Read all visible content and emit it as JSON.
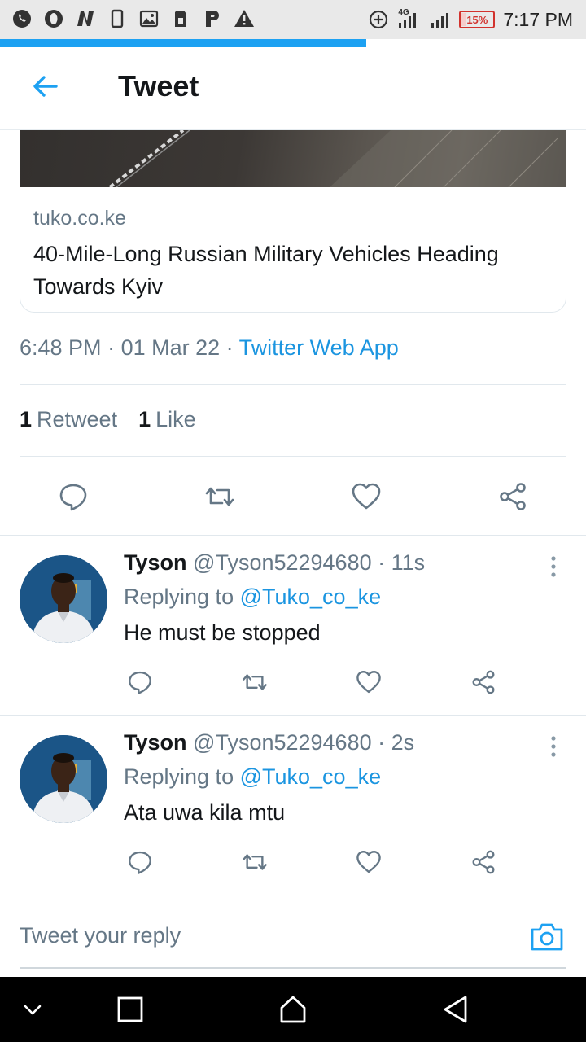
{
  "status_bar": {
    "time": "7:17 PM",
    "battery": "15%",
    "battery_level": 0.15,
    "network": "4G",
    "notification_icons": [
      "whatsapp-icon",
      "opera-icon",
      "n-news-icon",
      "phone-icon",
      "gallery-icon",
      "sim-icon",
      "p-app-icon",
      "warning-icon"
    ]
  },
  "page_load_progress": 0.625,
  "header": {
    "title": "Tweet"
  },
  "link_card": {
    "domain": "tuko.co.ke",
    "title": "40-Mile-Long Russian Military Vehicles Heading Towards Kyiv"
  },
  "tweet_meta": {
    "time": "6:48 PM",
    "date": "01 Mar 22",
    "separator": " · ",
    "source": "Twitter Web App"
  },
  "stats": {
    "retweet_count": "1",
    "retweet_label": "Retweet",
    "like_count": "1",
    "like_label": "Like"
  },
  "replies": [
    {
      "name": "Tyson",
      "handle": "@Tyson52294680",
      "time": "· 11s",
      "replying_prefix": "Replying to",
      "replying_to": "@Tuko_co_ke",
      "text": "He must be stopped"
    },
    {
      "name": "Tyson",
      "handle": "@Tyson52294680",
      "time": "· 2s",
      "replying_prefix": "Replying to",
      "replying_to": "@Tuko_co_ke",
      "text": "Ata uwa kila mtu"
    }
  ],
  "compose": {
    "placeholder": "Tweet your reply"
  },
  "colors": {
    "accent": "#1da1f2",
    "link": "#1b95e0",
    "secondary_text": "#657786",
    "battery_low": "#d2322d"
  }
}
